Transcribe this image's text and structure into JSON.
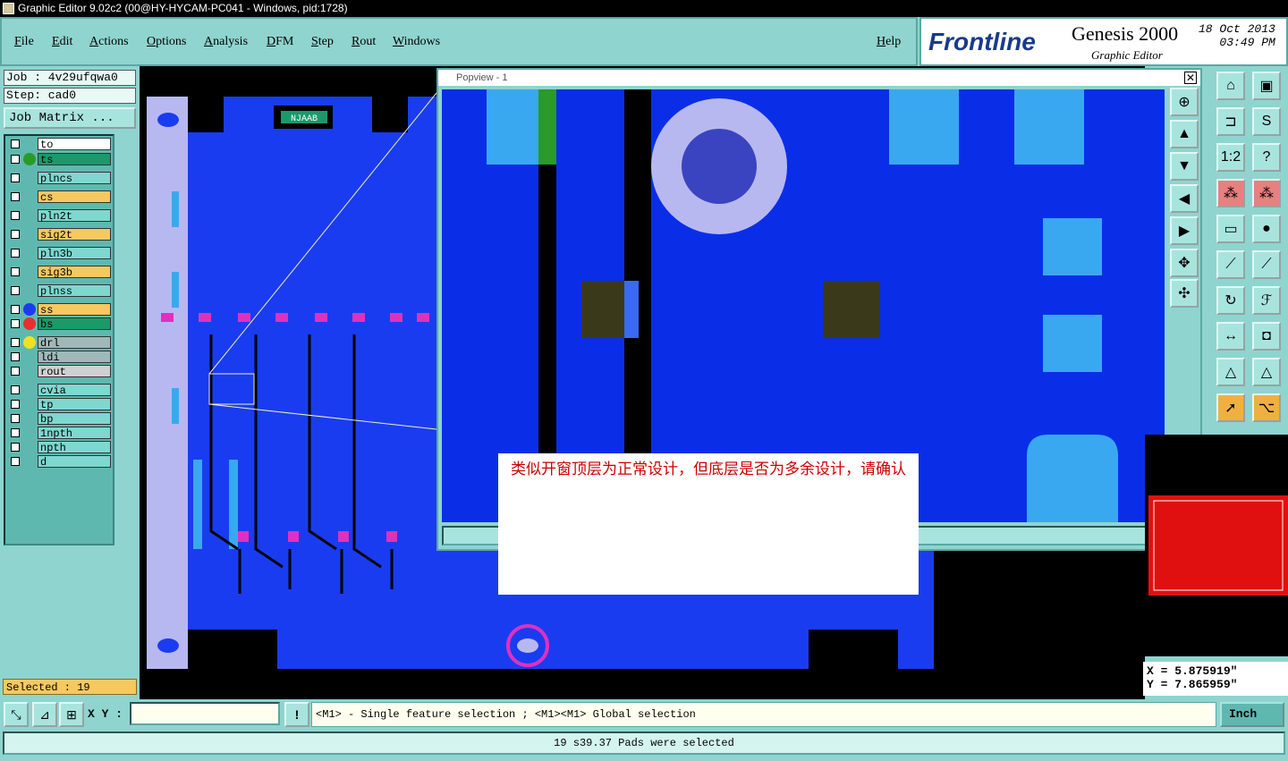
{
  "window": {
    "title": "Graphic Editor 9.02c2 (00@HY-HYCAM-PC041 - Windows, pid:1728)"
  },
  "menu": {
    "file": "File",
    "edit": "Edit",
    "actions": "Actions",
    "options": "Options",
    "analysis": "Analysis",
    "dfm": "DFM",
    "step": "Step",
    "rout": "Rout",
    "windows": "Windows",
    "help": "Help"
  },
  "brand": {
    "logo_prefix": "F",
    "logo_rest": "rontline",
    "product": "Genesis 2000",
    "subtitle": "Graphic Editor",
    "date": "18 Oct 2013",
    "time": "03:49 PM"
  },
  "job": {
    "job_line": "Job : 4v29ufqwa0",
    "step_line": "Step: cad0",
    "matrix_button": "Job Matrix ..."
  },
  "layers": [
    {
      "name": "to",
      "color": "#ffffff",
      "dot": ""
    },
    {
      "name": "ts",
      "color": "#1a9a6a",
      "dot": "#2a9a2a"
    },
    {
      "name": "plncs",
      "color": "#7ed8d0",
      "dot": ""
    },
    {
      "name": "cs",
      "color": "#f6c860",
      "dot": ""
    },
    {
      "name": "pln2t",
      "color": "#7ed8d0",
      "dot": ""
    },
    {
      "name": "sig2t",
      "color": "#f6c860",
      "dot": ""
    },
    {
      "name": "pln3b",
      "color": "#7ed8d0",
      "dot": ""
    },
    {
      "name": "sig3b",
      "color": "#f6c860",
      "dot": ""
    },
    {
      "name": "plnss",
      "color": "#7ed8d0",
      "dot": ""
    },
    {
      "name": "ss",
      "color": "#f6c860",
      "dot": "#1a3cf0"
    },
    {
      "name": "bs",
      "color": "#1a9a6a",
      "dot": "#e83030"
    },
    {
      "name": "drl",
      "color": "#a0b8b8",
      "dot": "#f0e020"
    },
    {
      "name": "ldi",
      "color": "#a0b8b8",
      "dot": ""
    },
    {
      "name": "rout",
      "color": "#d0d0d0",
      "dot": ""
    },
    {
      "name": "cvia",
      "color": "#7ed8d0",
      "dot": ""
    },
    {
      "name": "tp",
      "color": "#7ed8d0",
      "dot": ""
    },
    {
      "name": "bp",
      "color": "#7ed8d0",
      "dot": ""
    },
    {
      "name": "1npth",
      "color": "#7ed8d0",
      "dot": ""
    },
    {
      "name": "npth",
      "color": "#7ed8d0",
      "dot": ""
    },
    {
      "name": "d",
      "color": "#7ed8d0",
      "dot": ""
    }
  ],
  "selected": "Selected : 19",
  "popview": {
    "title": "Popview - 1",
    "close": "✕"
  },
  "annotation": "类似开窗顶层为正常设计，但底层是否为多余设计，请确认",
  "coords": {
    "x": "X = 5.875919\"",
    "y": "Y = 7.865959\""
  },
  "bottom": {
    "xy_label": "X Y :",
    "xy_value": "",
    "alert": "!",
    "help_text": "<M1> - Single feature selection ; <M1><M1> Global selection",
    "units": "Inch"
  },
  "status": "19 s39.37 Pads were selected",
  "colors": {
    "board": "#1a3cf0",
    "pad_light": "#3aa8f0",
    "pad_dark": "#3a3a1a",
    "ring": "#b8b8f0",
    "annotation_text": "#cc0000"
  },
  "board_label": "NJAAB"
}
